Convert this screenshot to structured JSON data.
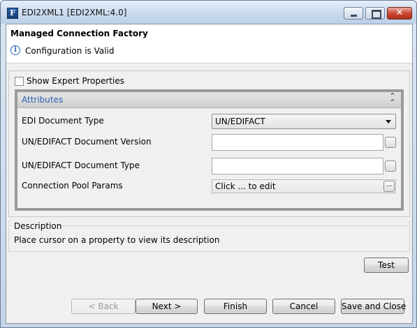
{
  "window": {
    "title": "EDI2XML1 [EDI2XML:4.0]",
    "app_icon_letter": "F",
    "close_glyph": "✕"
  },
  "header": {
    "title": "Managed Connection Factory",
    "info_glyph": "i",
    "status": "Configuration is Valid"
  },
  "options": {
    "show_expert_label": "Show Expert Properties",
    "show_expert_checked": false
  },
  "attributes": {
    "title": "Attributes",
    "collapse_glyph": "⌃⌃",
    "properties": [
      {
        "label": "EDI Document Type",
        "value": "UN/EDIFACT",
        "kind": "combo"
      },
      {
        "label": "UN/EDIFACT Document Version",
        "value": "",
        "kind": "text"
      },
      {
        "label": "UN/EDIFACT Document Type",
        "value": "",
        "kind": "text"
      },
      {
        "label": "Connection Pool Params",
        "value": "Click ... to edit",
        "kind": "link"
      }
    ],
    "ellipsis_glyph": "..."
  },
  "description": {
    "title": "Description",
    "text": "Place cursor on a property to view its description"
  },
  "buttons": {
    "test": "Test",
    "back": "< Back",
    "next": "Next >",
    "finish": "Finish",
    "cancel": "Cancel",
    "save_close": "Save and Close"
  }
}
